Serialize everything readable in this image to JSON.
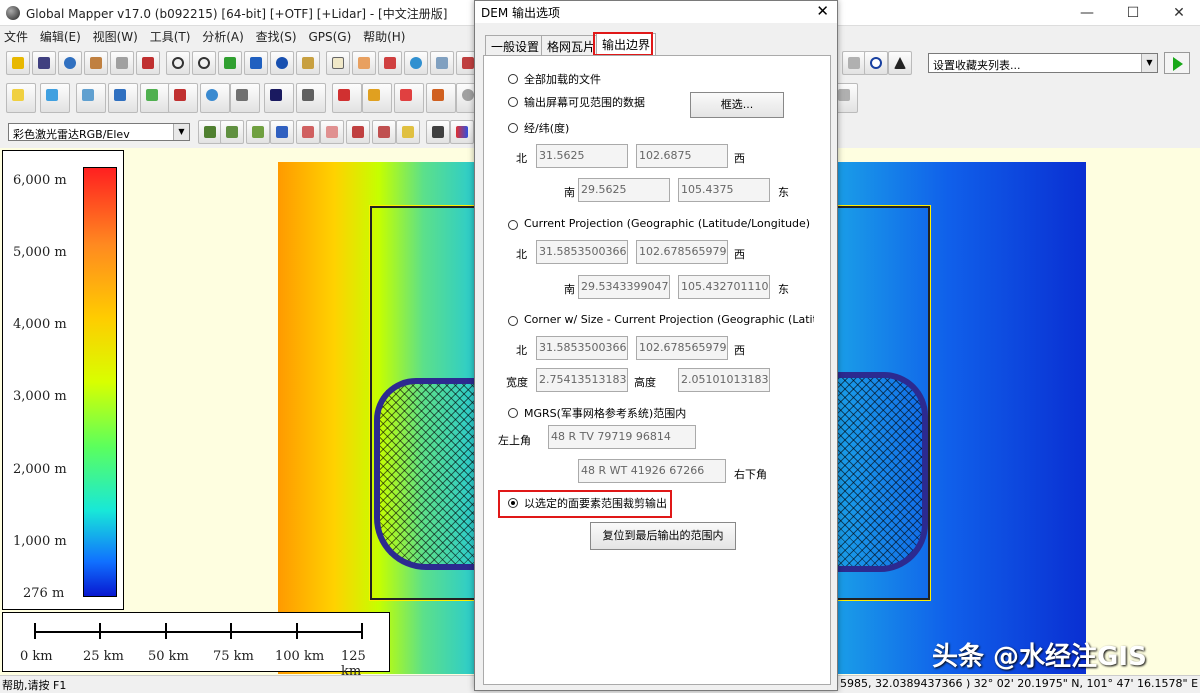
{
  "app": {
    "title": "Global Mapper v17.0 (b092215) [64-bit] [+OTF] [+Lidar] - [中文注册版]",
    "window_controls": [
      "—",
      "☐",
      "✕"
    ]
  },
  "menu": [
    "文件",
    "编辑(E)",
    "视图(W)",
    "工具(T)",
    "分析(A)",
    "查找(S)",
    "GPS(G)",
    "帮助(H)"
  ],
  "toolbar": {
    "layer_select_value": "彩色激光雷达RGB/Elev",
    "favorites_select_value": "设置收藏夹列表...",
    "tool_buttons": [
      "button-1",
      "button-2",
      "button-3",
      "button-4",
      "button-5",
      "button-6"
    ]
  },
  "legend": {
    "labels": [
      "6,000 m",
      "5,000 m",
      "4,000 m",
      "3,000 m",
      "2,000 m",
      "1,000 m",
      "276 m"
    ]
  },
  "scalebar": {
    "labels": [
      "0 km",
      "25 km",
      "50 km",
      "75 km",
      "100 km",
      "125 km"
    ]
  },
  "status": {
    "help": "帮助,请按 F1",
    "coords": "5985, 32.0389437366 ) 32° 02' 20.1975\" N, 101° 47' 16.1578\" E"
  },
  "watermark": "头条 @水经注GIS",
  "dialog": {
    "title": "DEM 输出选项",
    "close": "✕",
    "tabs": [
      "一般设置",
      "格网瓦片",
      "输出边界"
    ],
    "active_tab": "输出边界",
    "options": {
      "all_loaded": "全部加载的文件",
      "visible_screen": "输出屏幕可见范围的数据",
      "select_button": "框选...",
      "lat_lon": "经/纬(度)",
      "current_proj": "Current Projection (Geographic (Latitude/Longitude) -",
      "corner_size": "Corner w/ Size - Current Projection (Geographic (Latit",
      "mgrs": "MGRS(军事网格参考系统)范围内",
      "crop_selected": "以选定的面要素范围裁剪输出",
      "reset_button": "复位到最后输出的范围内"
    },
    "selected_option": "crop_selected",
    "labels": {
      "north": "北",
      "south": "南",
      "west": "西",
      "east": "东",
      "width": "宽度",
      "height": "高度",
      "upper_left": "左上角",
      "lower_right": "右下角"
    },
    "latlon": {
      "north": "31.5625",
      "west": "102.6875",
      "south": "29.5625",
      "east": "105.4375"
    },
    "proj": {
      "north": "31.58535003662",
      "west": "102.6785659790",
      "south": "29.53433990478",
      "east": "105.4327011108"
    },
    "corner": {
      "north": "31.58535003662",
      "west": "102.6785659790",
      "width": "2.754135131835",
      "height": "2.051010131835"
    },
    "mgrs": {
      "upper_left": "48 R TV 79719 96814",
      "lower_right": "48 R WT 41926 67266"
    }
  }
}
